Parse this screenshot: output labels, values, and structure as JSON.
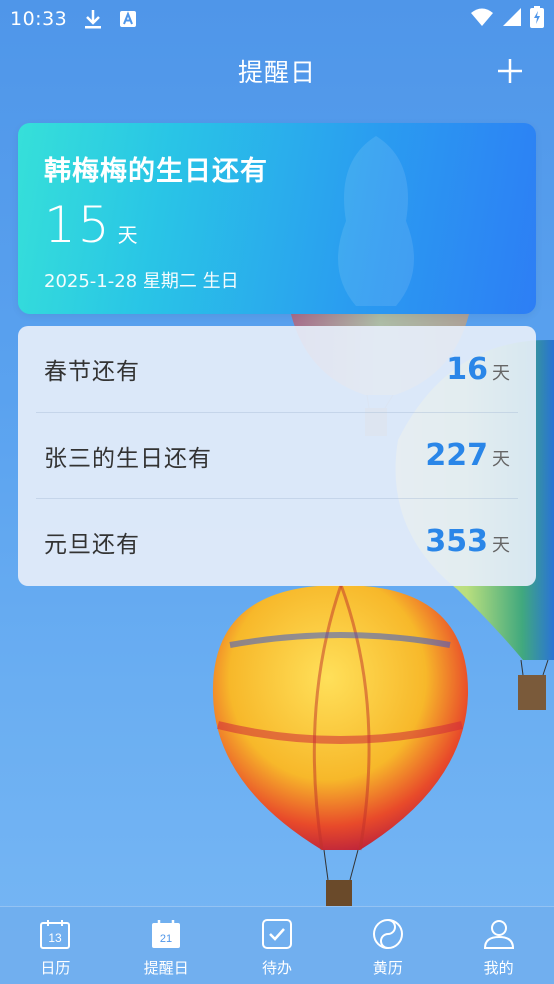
{
  "status_bar": {
    "time": "10:33",
    "icons": [
      "download-icon",
      "a-badge-icon",
      "wifi-icon",
      "signal-icon",
      "battery-charging-icon"
    ]
  },
  "header": {
    "title": "提醒日",
    "add_icon": "plus-icon"
  },
  "hero": {
    "title": "韩梅梅的生日还有",
    "days": "15",
    "unit": "天",
    "date_line": "2025-1-28 星期二 生日"
  },
  "reminders": [
    {
      "label": "春节还有",
      "count": "16",
      "unit": "天"
    },
    {
      "label": "张三的生日还有",
      "count": "227",
      "unit": "天"
    },
    {
      "label": "元旦还有",
      "count": "353",
      "unit": "天"
    }
  ],
  "bottom_nav": {
    "items": [
      {
        "label": "日历",
        "icon": "calendar-icon",
        "icon_text": "13"
      },
      {
        "label": "提醒日",
        "icon": "reminder-calendar-icon",
        "icon_text": "21"
      },
      {
        "label": "待办",
        "icon": "checkbox-icon"
      },
      {
        "label": "黄历",
        "icon": "yinyang-icon"
      },
      {
        "label": "我的",
        "icon": "user-icon"
      }
    ]
  },
  "colors": {
    "accent": "#2a86e8",
    "card_gradient_start": "#36e0d9",
    "card_gradient_end": "#2d7ef5"
  }
}
